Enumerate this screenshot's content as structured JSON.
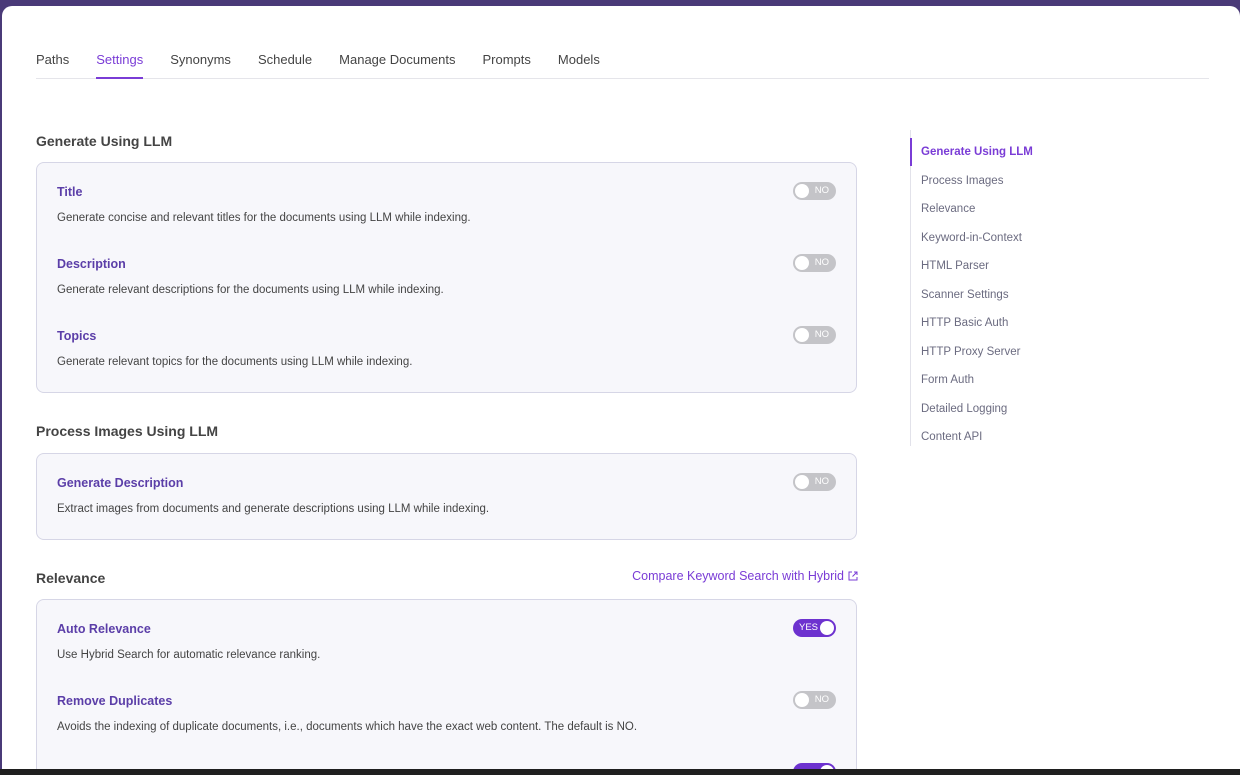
{
  "tabs": [
    "Paths",
    "Settings",
    "Synonyms",
    "Schedule",
    "Manage Documents",
    "Prompts",
    "Models"
  ],
  "active_tab": "Settings",
  "sections": {
    "llm": {
      "title": "Generate Using LLM",
      "rows": [
        {
          "title": "Title",
          "desc": "Generate concise and relevant titles for the documents using LLM while indexing.",
          "toggle": "NO"
        },
        {
          "title": "Description",
          "desc": "Generate relevant descriptions for the documents using LLM while indexing.",
          "toggle": "NO"
        },
        {
          "title": "Topics",
          "desc": "Generate relevant topics for the documents using LLM while indexing.",
          "toggle": "NO"
        }
      ]
    },
    "images": {
      "title": "Process Images Using LLM",
      "rows": [
        {
          "title": "Generate Description",
          "desc": "Extract images from documents and generate descriptions using LLM while indexing.",
          "toggle": "NO"
        }
      ]
    },
    "relevance": {
      "title": "Relevance",
      "link": "Compare Keyword Search with Hybrid",
      "rows": [
        {
          "title": "Auto Relevance",
          "desc": "Use Hybrid Search for automatic relevance ranking.",
          "toggle": "YES"
        },
        {
          "title": "Remove Duplicates",
          "desc": "Avoids the indexing of duplicate documents, i.e., documents which have the exact web content. The default is NO.",
          "toggle": "NO"
        }
      ]
    }
  },
  "sidenav": {
    "active": "Generate Using LLM",
    "items": [
      "Generate Using LLM",
      "Process Images",
      "Relevance",
      "Keyword-in-Context",
      "HTML Parser",
      "Scanner Settings",
      "HTTP Basic Auth",
      "HTTP Proxy Server",
      "Form Auth",
      "Detailed Logging",
      "Content API"
    ]
  },
  "colors": {
    "accent": "#7a3cd6",
    "toggle_on": "#6d32cf",
    "toggle_off": "#c4c4c8",
    "frame_bg": "#4a3a78"
  }
}
